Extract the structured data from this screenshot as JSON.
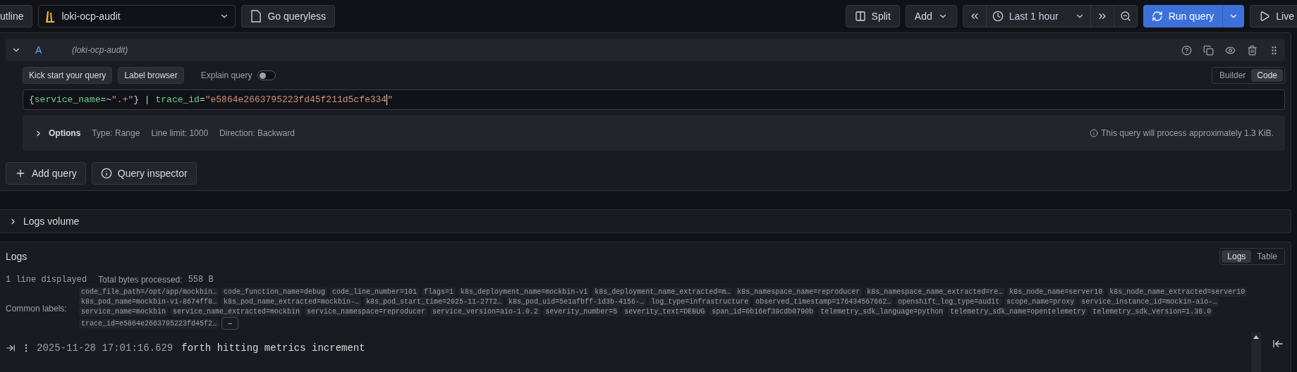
{
  "toolbar": {
    "outline": "utline",
    "datasource": "loki-ocp-audit",
    "queryless": "Go queryless",
    "split": "Split",
    "add": "Add",
    "time_range": "Last 1 hour",
    "run": "Run query",
    "live": "Live"
  },
  "query": {
    "ref": "A",
    "datasource": "(loki-ocp-audit)",
    "kick_start": "Kick start your query",
    "label_browser": "Label browser",
    "explain": {
      "label": "Explain query",
      "on": false
    },
    "modes": [
      {
        "label": "Builder",
        "selected": false
      },
      {
        "label": "Code",
        "selected": true
      }
    ],
    "code": [
      {
        "kind": "punct",
        "text": "{"
      },
      {
        "kind": "label",
        "text": "service_name"
      },
      {
        "kind": "punct",
        "text": "=~"
      },
      {
        "kind": "string",
        "text": "\".+\""
      },
      {
        "kind": "punct",
        "text": "} | "
      },
      {
        "kind": "label",
        "text": "trace_id"
      },
      {
        "kind": "punct",
        "text": "="
      },
      {
        "kind": "string",
        "text": "\"e5864e2663795223fd45f211d5cfe334"
      },
      {
        "kind": "cursor"
      },
      {
        "kind": "string",
        "text": "\""
      }
    ],
    "options": {
      "title": "Options",
      "items": [
        "Type: Range",
        "Line limit: 1000",
        "Direction: Backward"
      ],
      "estimate": "This query will process approximately 1.3 KiB."
    }
  },
  "actions": [
    "Add query",
    "Query inspector"
  ],
  "logs_volume": {
    "title": "Logs volume",
    "expanded": false
  },
  "logs": {
    "title": "Logs",
    "views": [
      {
        "label": "Logs",
        "selected": true
      },
      {
        "label": "Table",
        "selected": false
      }
    ],
    "lines": "1 line displayed",
    "bytes_label": "Total bytes processed:",
    "bytes": "558 B",
    "common_labels_title": "Common labels:",
    "common_labels": [
      [
        "code_file_path=/opt/app/mockbin…",
        "code_function_name=debug",
        "code_line_number=101",
        "flags=1",
        "k8s_deployment_name=mockbin-v1",
        "k8s_deployment_name_extracted=m…",
        "k8s_namespace_name=reproducer",
        "k8s_namespace_name_extracted=re…",
        "k8s_node_name=server10",
        "k8s_node_name_extracted=server10"
      ],
      [
        "k8s_pod_name=mockbin-v1-8674ff8…",
        "k8s_pod_name_extracted=mockbin-…",
        "k8s_pod_start_time=2025-11-27T2…",
        "k8s_pod_uid=5e1afbff-1d3b-4156-…",
        "log_type=infrastructure",
        "observed_timestamp=176434567662…",
        "openshift_log_type=audit",
        "scope_name=proxy",
        "service_instance_id=mockin-aio-…"
      ],
      [
        "service_name=mockbin",
        "service_name_extracted=mockbin",
        "service_namespace=reproducer",
        "service_version=aio-1.0.2",
        "severity_number=5",
        "severity_text=DEBUG",
        "span_id=0b16ef39cdb0790b",
        "telemetry_sdk_language=python",
        "telemetry_sdk_name=opentelemetry",
        "telemetry_sdk_version=1.38.0"
      ],
      [
        "trace_id=e5864e2663795223fd45f2…"
      ]
    ],
    "collapse": "−",
    "rows": [
      {
        "time": "2025-11-28 17:01:16.629",
        "message": "forth hitting metrics increment"
      }
    ]
  }
}
